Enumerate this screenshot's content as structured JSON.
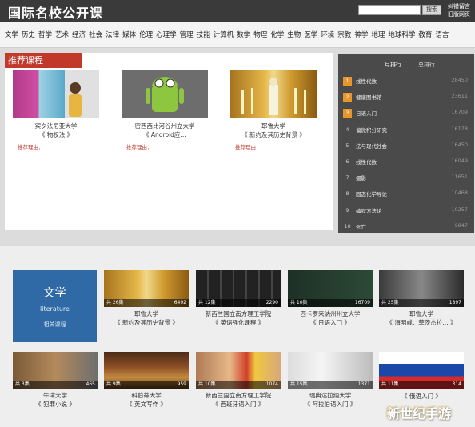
{
  "header": {
    "logo": "国际名校公开课",
    "search_placeholder": "",
    "search_button": "搜索",
    "links": [
      "纠错留言",
      "旧版网页"
    ]
  },
  "categories": [
    "文学",
    "历史",
    "哲学",
    "艺术",
    "经济",
    "社会",
    "法律",
    "媒体",
    "伦理",
    "心理学",
    "管理",
    "技能",
    "计算机",
    "数学",
    "物理",
    "化学",
    "生物",
    "医学",
    "环境",
    "宗教",
    "神学",
    "地理",
    "地球科学",
    "教育",
    "语言"
  ],
  "recommended": {
    "title": "推荐课程",
    "items": [
      {
        "school": "宾夕法尼亚大学",
        "course": "《 物权法 》",
        "reason": "推荐理由：",
        "image": "books"
      },
      {
        "school": "密西西比河谷州立大学",
        "course": "《 Android应…",
        "reason": "推荐理由：",
        "image": "android"
      },
      {
        "school": "耶鲁大学",
        "course": "《 新约及其历史背景 》",
        "reason": "推荐理由：",
        "image": "candles"
      }
    ]
  },
  "ranking": {
    "tabs": [
      "月排行",
      "总排行"
    ],
    "rows": [
      {
        "num": "1",
        "title": "线性代数",
        "count": "28450"
      },
      {
        "num": "2",
        "title": "健康图书馆",
        "count": "23611"
      },
      {
        "num": "3",
        "title": "日语入门",
        "count": "16709"
      },
      {
        "num": "4",
        "title": "偏微积分研究",
        "count": "16178"
      },
      {
        "num": "5",
        "title": "法与现代社会",
        "count": "16450"
      },
      {
        "num": "6",
        "title": "线性代数",
        "count": "16049"
      },
      {
        "num": "7",
        "title": "摄影",
        "count": "11651"
      },
      {
        "num": "8",
        "title": "固态化学导论",
        "count": "10468"
      },
      {
        "num": "9",
        "title": "编程方法论",
        "count": "10257"
      },
      {
        "num": "10",
        "title": "死亡",
        "count": "9847"
      }
    ]
  },
  "literature_tile": {
    "cn": "文学",
    "en": "literature",
    "more": "相关课程"
  },
  "courses": [
    {
      "school": "耶鲁大学",
      "course": "《 新约及其历史背景 》",
      "episodes": "共 26集",
      "views": "6492",
      "image": "candles"
    },
    {
      "school": "新西兰国立南方理工学院",
      "course": "《 英语强化课程 》",
      "episodes": "共 12集",
      "views": "2290",
      "image": "keys"
    },
    {
      "school": "西卡罗来纳州州立大学",
      "course": "《 日语入门 》",
      "episodes": "共 10集",
      "views": "16709",
      "image": "board"
    },
    {
      "school": "耶鲁大学",
      "course": "《 海明威、菲茨杰拉… 》",
      "episodes": "共 25集",
      "views": "1897",
      "image": "hemingway"
    },
    {
      "school": "牛津大学",
      "course": "《 犯罪小说 》",
      "episodes": "共 3集",
      "views": "465",
      "image": "reader"
    },
    {
      "school": "科伯蒂大学",
      "course": "《 英文写作 》",
      "episodes": "共 9集",
      "views": "959",
      "image": "stack"
    },
    {
      "school": "新西兰国立南方理工学院",
      "course": "《 西班牙语入门 》",
      "episodes": "共 10集",
      "views": "1074",
      "image": "face"
    },
    {
      "school": "瑞典达拉纳大学",
      "course": "《 阿拉伯语入门 》",
      "episodes": "共 15集",
      "views": "1371",
      "image": "meeting"
    },
    {
      "school": "",
      "course": "《 俄语入门 》",
      "episodes": "共 11集",
      "views": "314",
      "image": "flag"
    }
  ],
  "watermark": "新世纪手游"
}
